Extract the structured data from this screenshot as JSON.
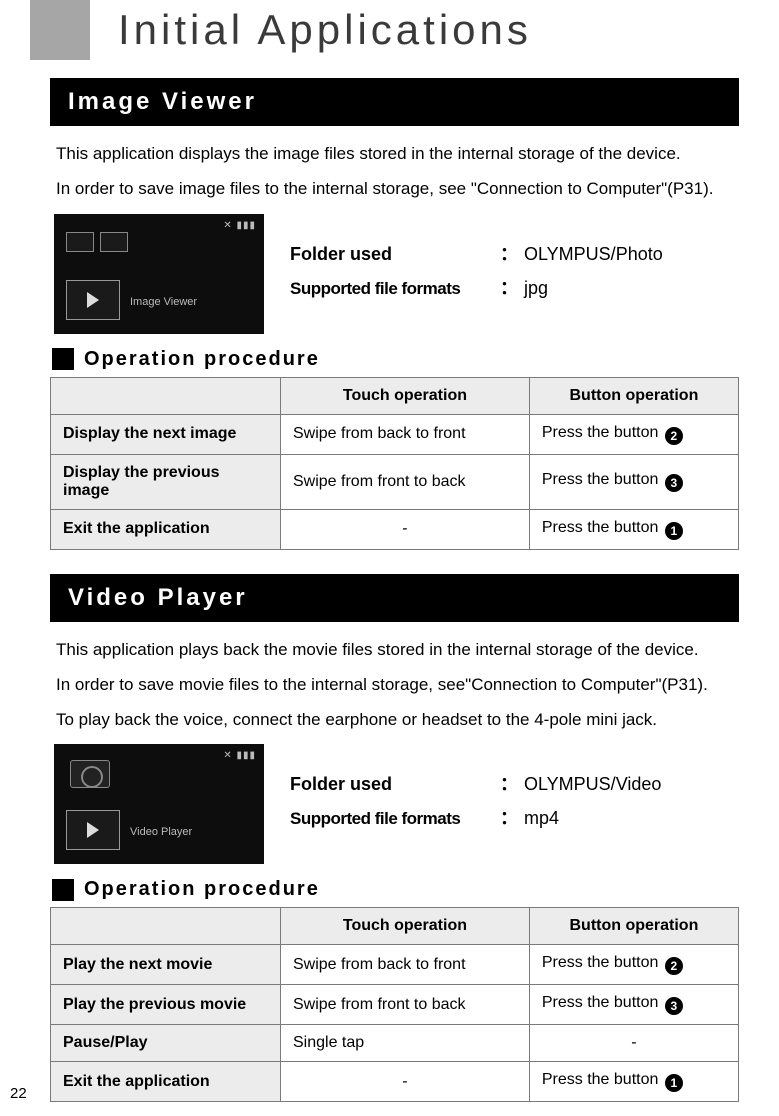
{
  "page": {
    "title": "Initial Applications",
    "number": "22"
  },
  "sections": [
    {
      "id": "image-viewer",
      "heading": "Image Viewer",
      "descriptions": [
        "This application displays the image files stored in the internal storage of the device.",
        "In order to save image files to the internal storage, see \"Connection to Computer\"(P31)."
      ],
      "thumb_caption": "Image Viewer",
      "specs": {
        "folder_label": "Folder used",
        "folder_value": "OLYMPUS/Photo",
        "formats_label": "Supported file formats",
        "formats_value": "jpg"
      },
      "op_title": "Operation procedure",
      "table": {
        "headers": [
          "",
          "Touch operation",
          "Button operation"
        ],
        "rows": [
          {
            "label": "Display the next image",
            "touch": "Swipe from back to front",
            "button_text": "Press the button",
            "button_num": "2"
          },
          {
            "label": "Display the previous image",
            "touch": "Swipe from front to back",
            "button_text": "Press the button",
            "button_num": "3"
          },
          {
            "label": "Exit the application",
            "touch": "-",
            "touch_center": true,
            "button_text": "Press the button",
            "button_num": "1"
          }
        ]
      }
    },
    {
      "id": "video-player",
      "heading": "Video Player",
      "descriptions": [
        "This application plays back the movie files stored in the internal storage of the device.",
        "In order to save movie files to the internal storage, see\"Connection to Computer\"(P31).",
        "To play back the voice, connect the earphone or headset to the 4-pole mini jack."
      ],
      "thumb_caption": "Video Player",
      "specs": {
        "folder_label": "Folder used",
        "folder_value": "OLYMPUS/Video",
        "formats_label": "Supported file formats",
        "formats_value": "mp4"
      },
      "op_title": "Operation procedure",
      "table": {
        "headers": [
          "",
          "Touch operation",
          "Button operation"
        ],
        "rows": [
          {
            "label": "Play the next movie",
            "touch": "Swipe from back to front",
            "button_text": "Press the button",
            "button_num": "2"
          },
          {
            "label": "Play the previous movie",
            "touch": "Swipe from front to back",
            "button_text": "Press the button",
            "button_num": "3"
          },
          {
            "label": "Pause/Play",
            "touch": "Single tap",
            "button_text": "-",
            "button_center": true
          },
          {
            "label": "Exit the application",
            "touch": "-",
            "touch_center": true,
            "button_text": "Press the button",
            "button_num": "1"
          }
        ]
      }
    }
  ]
}
